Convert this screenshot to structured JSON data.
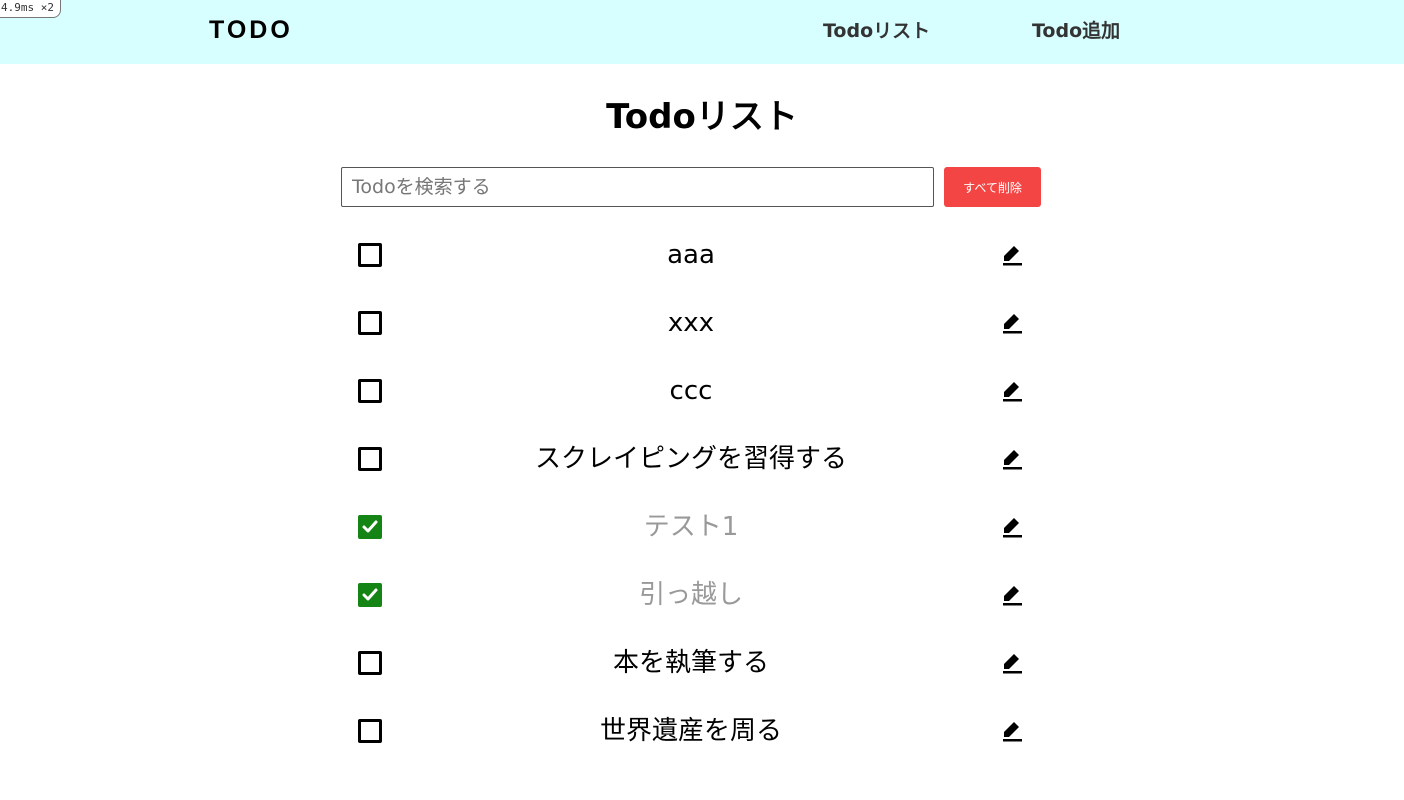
{
  "debug": {
    "badge": "4.9ms ×2"
  },
  "header": {
    "logo": "TODO",
    "nav": [
      {
        "label": "Todoリスト"
      },
      {
        "label": "Todo追加"
      }
    ]
  },
  "main": {
    "title": "Todoリスト",
    "search": {
      "placeholder": "Todoを検索する",
      "value": ""
    },
    "delete_all_label": "すべて削除"
  },
  "todos": [
    {
      "text": "aaa",
      "completed": false
    },
    {
      "text": "xxx",
      "completed": false
    },
    {
      "text": "ccc",
      "completed": false
    },
    {
      "text": "スクレイピングを習得する",
      "completed": false
    },
    {
      "text": "テスト1",
      "completed": true
    },
    {
      "text": "引っ越し",
      "completed": true
    },
    {
      "text": "本を執筆する",
      "completed": false
    },
    {
      "text": "世界遺産を周る",
      "completed": false
    }
  ],
  "colors": {
    "header_bg": "#d8ffff",
    "delete_button": "#f44545",
    "checked": "#148514",
    "completed_text": "#999999"
  },
  "icons": {
    "checkbox": "check-icon",
    "edit": "pencil-icon"
  }
}
